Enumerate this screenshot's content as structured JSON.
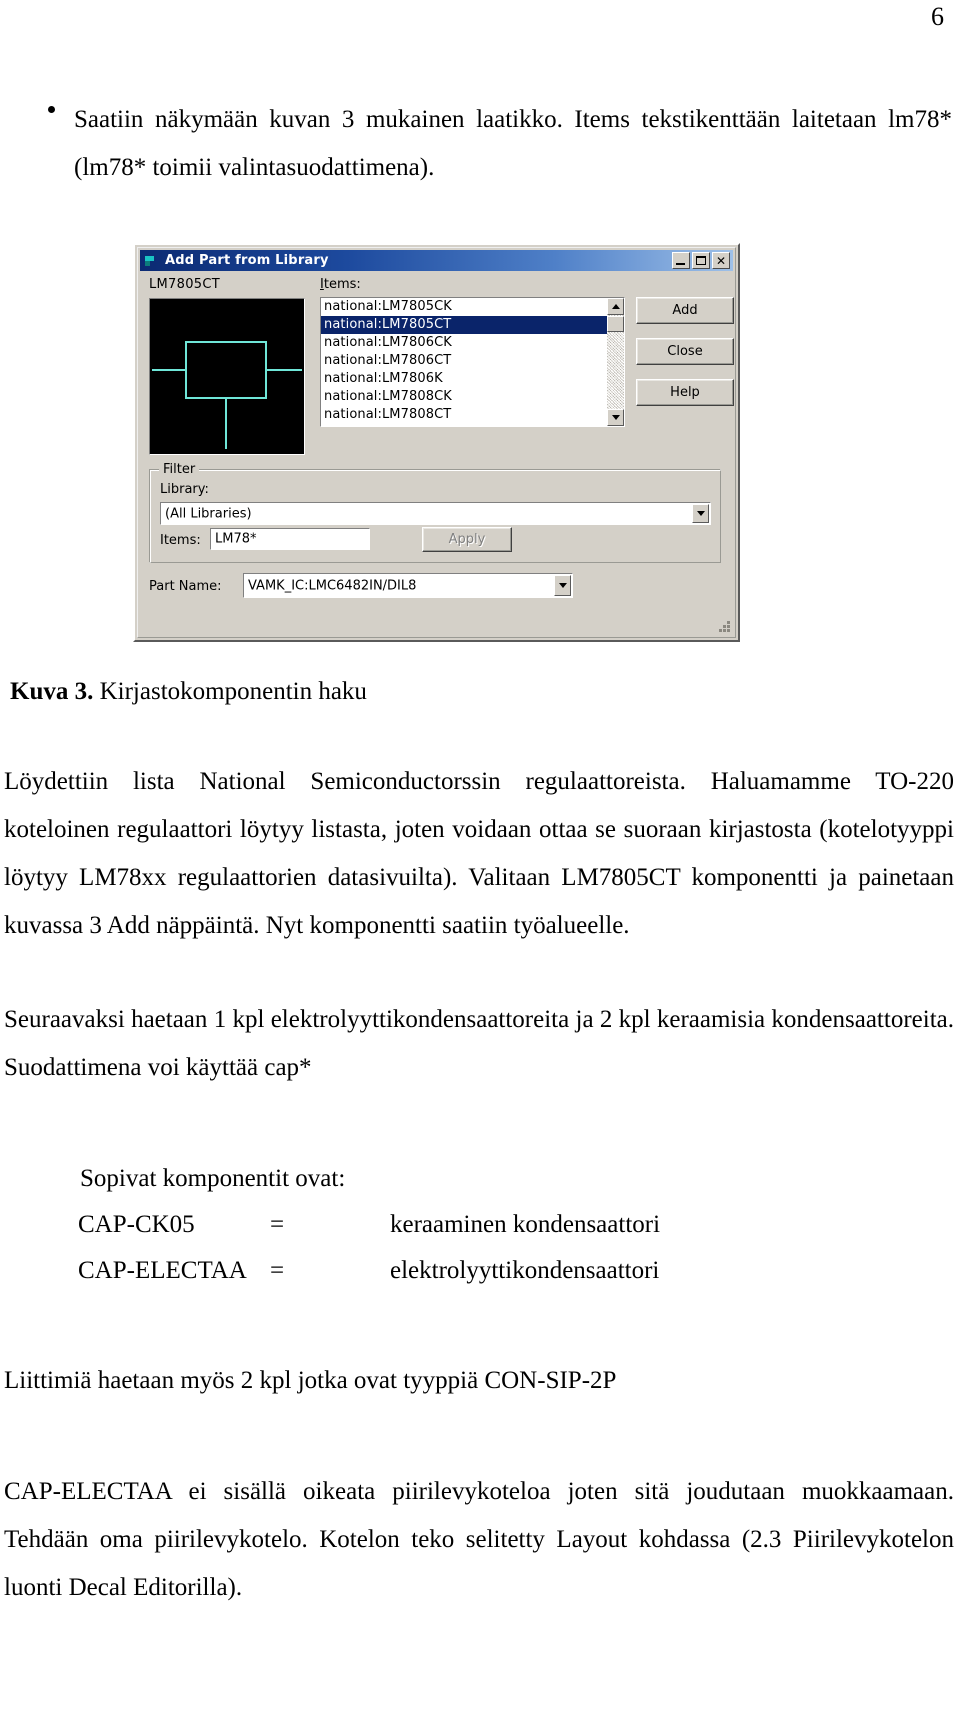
{
  "page": {
    "number": "6"
  },
  "bullet": {
    "text": "Saatiin näkymään kuvan 3 mukainen laatikko. Items tekstikenttään laitetaan lm78* (lm78* toimii valintasuodattimena)."
  },
  "dialog": {
    "title": "Add Part from Library",
    "icon": "library-flag-icon",
    "window_controls": {
      "minimize": "minimize-icon",
      "maximize": "maximize-icon",
      "close": "close-icon"
    },
    "preview": {
      "label": "LM7805CT",
      "symbol_color": "#6fe6d8",
      "background": "#000000"
    },
    "items": {
      "label": "Items:",
      "selected": "national:LM7805CT",
      "options": [
        "national:LM7805CK",
        "national:LM7805CT",
        "national:LM7806CK",
        "national:LM7806CT",
        "national:LM7806K",
        "national:LM7808CK",
        "national:LM7808CT"
      ]
    },
    "buttons": {
      "add": "Add",
      "close": "Close",
      "help": "Help",
      "apply": "Apply"
    },
    "filter": {
      "legend": "Filter",
      "library_label": "Library:",
      "library_value": "(All Libraries)",
      "items_label": "Items:",
      "items_value": "LM78*"
    },
    "part_name": {
      "label": "Part Name:",
      "value": "VAMK_IC:LMC6482IN/DIL8"
    },
    "accent_title_color": "#0b2a72",
    "face_color": "#d4d0c8",
    "selection_color": "#0a246a"
  },
  "caption": {
    "figure": "Kuva 3.",
    "text": "Kirjastokomponentin haku"
  },
  "paragraphs": {
    "p1": "Löydettiin lista National Semiconductorssin regulaattoreista. Haluamamme TO-220 koteloinen regulaattori löytyy listasta, joten voidaan ottaa se suoraan kirjastosta (kotelotyyppi löytyy LM78xx regulaattorien datasivuilta). Valitaan LM7805CT komponentti ja painetaan kuvassa 3 Add näppäintä. Nyt komponentti saatiin työalueelle.",
    "p2": "Seuraavaksi haetaan 1 kpl elektrolyyttikondensaattoreita ja 2 kpl keraamisia kondensaattoreita. Suodattimena voi käyttää cap*",
    "p3": "Liittimiä haetaan myös 2 kpl jotka ovat tyyppiä CON-SIP-2P",
    "p4": "CAP-ELECTAA ei sisällä oikeata piirilevykoteloa joten sitä joudutaan muokkaamaan. Tehdään oma piirilevykotelo. Kotelon teko selitetty Layout kohdassa (2.3 Piirilevykotelon luonti Decal Editorilla)."
  },
  "components": {
    "intro": "Sopivat komponentit ovat:",
    "rows": [
      {
        "name": "CAP-CK05",
        "eq": "=",
        "desc": "keraaminen kondensaattori"
      },
      {
        "name": "CAP-ELECTAA",
        "eq": "=",
        "desc": "elektrolyyttikondensaattori"
      }
    ]
  }
}
